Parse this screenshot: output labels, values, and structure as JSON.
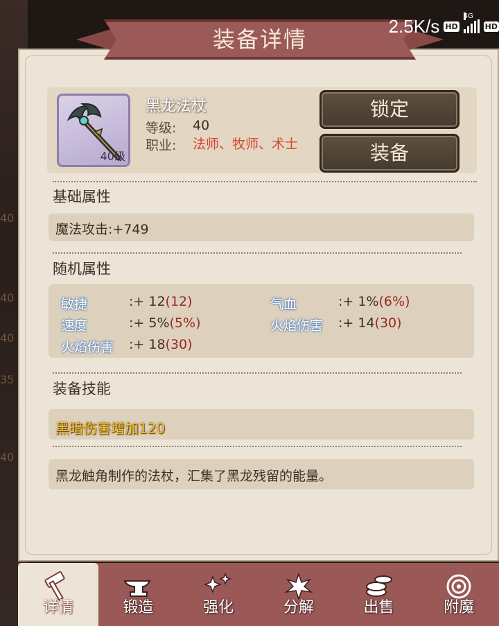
{
  "status_bar": {
    "speed": "2.5K/s",
    "hd_badge": "HD",
    "network": "4G"
  },
  "background": {
    "level_labels": [
      "40",
      "40",
      "40",
      "35",
      "40"
    ]
  },
  "panel": {
    "title": "装备详情"
  },
  "item": {
    "name": "黑龙法杖",
    "icon_level": "40级",
    "level_label": "等级:",
    "level_value": "40",
    "class_label": "职业:",
    "class_value": "法师、牧师、术士"
  },
  "buttons": {
    "lock": "锁定",
    "equip": "装备"
  },
  "base_attributes": {
    "title": "基础属性",
    "line": "魔法攻击:+749"
  },
  "random_attributes": {
    "title": "随机属性",
    "rows": [
      {
        "name": "敏捷",
        "value": ":+ 12",
        "max": "(12)"
      },
      {
        "name": "气血",
        "value": ":+ 1%",
        "max": "(6%)"
      },
      {
        "name": "速度",
        "value": ":+ 5%",
        "max": "(5%)"
      },
      {
        "name": "火焰伤害",
        "value": ":+ 14",
        "max": "(30)"
      },
      {
        "name": "火焰伤害",
        "value": ":+ 18",
        "max": "(30)"
      }
    ]
  },
  "equip_skill": {
    "title": "装备技能",
    "skill": "黑暗伤害增加120"
  },
  "description": "黑龙触角制作的法杖，汇集了黑龙残留的能量。",
  "nav": {
    "tabs": [
      {
        "label": "详情",
        "icon": "hammer-icon",
        "active": true
      },
      {
        "label": "锻造",
        "icon": "anvil-icon"
      },
      {
        "label": "强化",
        "icon": "sparkle-icon"
      },
      {
        "label": "分解",
        "icon": "burst-icon"
      },
      {
        "label": "出售",
        "icon": "coins-icon"
      },
      {
        "label": "附魔",
        "icon": "enchant-icon"
      }
    ]
  }
}
